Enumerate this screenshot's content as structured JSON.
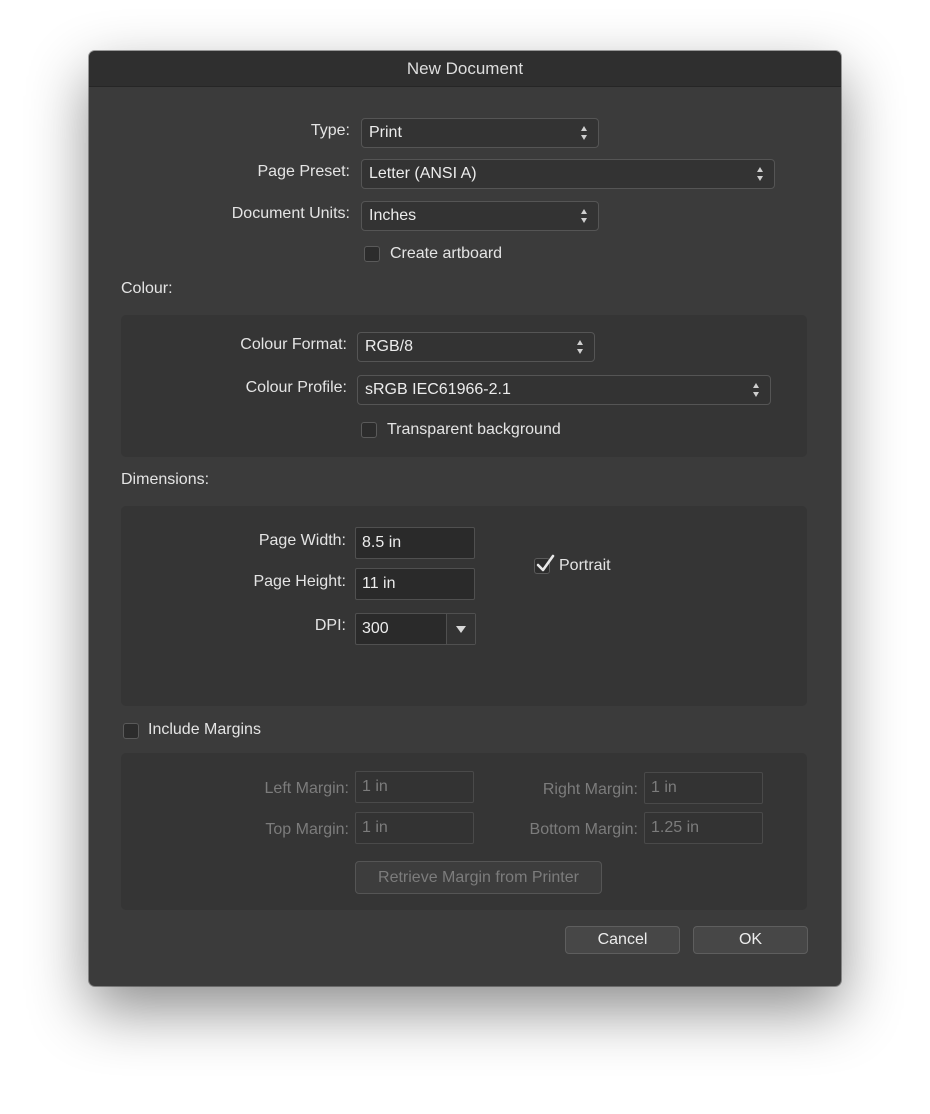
{
  "dialog": {
    "title": "New Document"
  },
  "general": {
    "type_label": "Type:",
    "type_value": "Print",
    "preset_label": "Page Preset:",
    "preset_value": "Letter (ANSI A)",
    "units_label": "Document Units:",
    "units_value": "Inches",
    "artboard_label": "Create artboard",
    "artboard_checked": false
  },
  "colour": {
    "section_label": "Colour:",
    "format_label": "Colour Format:",
    "format_value": "RGB/8",
    "profile_label": "Colour Profile:",
    "profile_value": "sRGB IEC61966-2.1",
    "transparent_label": "Transparent background",
    "transparent_checked": false
  },
  "dimensions": {
    "section_label": "Dimensions:",
    "width_label": "Page Width:",
    "width_value": "8.5 in",
    "height_label": "Page Height:",
    "height_value": "11 in",
    "dpi_label": "DPI:",
    "dpi_value": "300",
    "portrait_label": "Portrait",
    "portrait_checked": true
  },
  "margins": {
    "include_label": "Include Margins",
    "include_checked": false,
    "left_label": "Left Margin:",
    "left_value": "1 in",
    "right_label": "Right Margin:",
    "right_value": "1 in",
    "top_label": "Top Margin:",
    "top_value": "1 in",
    "bottom_label": "Bottom Margin:",
    "bottom_value": "1.25 in",
    "retrieve_label": "Retrieve Margin from Printer"
  },
  "buttons": {
    "cancel": "Cancel",
    "ok": "OK"
  },
  "colors": {
    "dialog_bg": "#3b3b3b",
    "group_bg": "#353535",
    "disabled_text": "#7c7c7c"
  }
}
